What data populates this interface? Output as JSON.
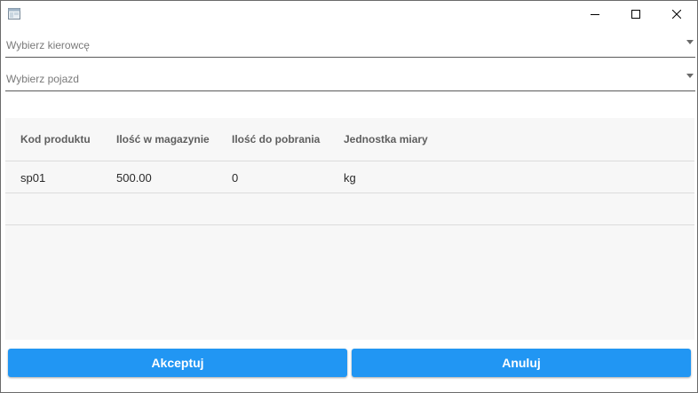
{
  "window": {
    "app_icon": "window-app-icon",
    "controls": {
      "minimize_icon": "minimize-icon",
      "maximize_icon": "maximize-icon",
      "close_icon": "close-icon"
    }
  },
  "form": {
    "driver_select": {
      "placeholder": "Wybierz kierowcę",
      "icon": "chevron-down-icon"
    },
    "vehicle_select": {
      "placeholder": "Wybierz pojazd",
      "icon": "chevron-down-icon"
    }
  },
  "table": {
    "columns": [
      "Kod produktu",
      "Ilość w magazynie",
      "Ilość do pobrania",
      "Jednostka miary"
    ],
    "rows": [
      [
        "sp01",
        "500.00",
        "0",
        "kg"
      ]
    ]
  },
  "actions": {
    "accept_label": "Akceptuj",
    "cancel_label": "Anuluj"
  },
  "colors": {
    "accent": "#2196f3",
    "table_background": "#f7f7f7",
    "header_text": "#5e5e5e"
  }
}
